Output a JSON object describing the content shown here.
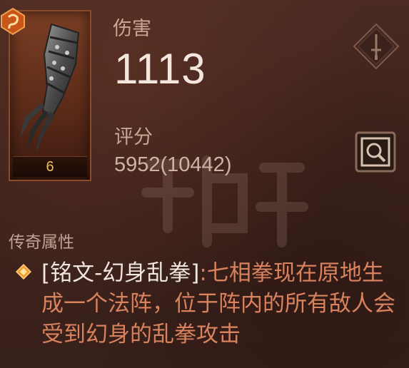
{
  "item": {
    "level": "6"
  },
  "stats": {
    "damage_label": "伤害",
    "damage_value": "1113",
    "score_label": "评分",
    "score_value": "5952(10442)"
  },
  "legendary": {
    "title": "传奇属性",
    "name": "[铭文-幻身乱拳]",
    "description": ":七相拳现在原地生成一个法阵，位于阵内的所有敌人会受到幻身的乱拳攻击"
  },
  "icons": {
    "rune_badge": "rune-badge-icon",
    "weapon_type": "sword-icon",
    "inspect": "magnifier-icon",
    "bullet": "diamond-bullet-icon"
  },
  "colors": {
    "background": "#3e231d",
    "legendary_text": "#d8825e",
    "name_text": "#f0e6dc",
    "damage_value": "#f2e6de",
    "level": "#e8c060",
    "frame": "#8a4a2c"
  }
}
